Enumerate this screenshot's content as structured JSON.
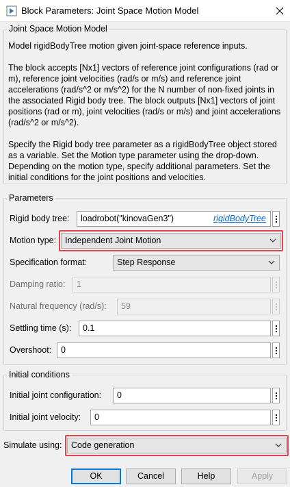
{
  "window": {
    "title": "Block Parameters: Joint Space Motion Model",
    "icon": "block-icon",
    "close_icon": "close-icon"
  },
  "block_group": {
    "label": "Joint Space Motion Model",
    "paragraph1": "Model rigidBodyTree motion given joint-space reference inputs.",
    "paragraph2": "The block accepts [Nx1] vectors of reference joint configurations (rad or m), reference joint velocities (rad/s or m/s) and reference joint accelerations (rad/s^2 or m/s^2) for the N number of non-fixed joints in the associated Rigid body tree. The block outputs [Nx1] vectors of joint positions (rad or m), joint velocities (rad/s or m/s) and joint accelerations (rad/s^2 or m/s^2).",
    "paragraph3": "Specify the Rigid body tree parameter as a rigidBodyTree object stored as a variable. Set the Motion type parameter using the drop-down. Depending on the motion type, specify additional parameters. Set the initial conditions for the joint positions and velocities."
  },
  "parameters": {
    "label": "Parameters",
    "rigid_body_tree": {
      "label": "Rigid body tree:",
      "value": "loadrobot(\"kinovaGen3\")",
      "link": "rigidBodyTree"
    },
    "motion_type": {
      "label": "Motion type:",
      "value": "Independent Joint Motion"
    },
    "specification_format": {
      "label": "Specification format:",
      "value": "Step Response"
    },
    "damping_ratio": {
      "label": "Damping ratio:",
      "value": "1"
    },
    "natural_frequency": {
      "label": "Natural frequency (rad/s):",
      "value": "59"
    },
    "settling_time": {
      "label": "Settling time (s):",
      "value": "0.1"
    },
    "overshoot": {
      "label": "Overshoot:",
      "value": "0"
    }
  },
  "initial_conditions": {
    "label": "Initial conditions",
    "joint_configuration": {
      "label": "Initial joint configuration:",
      "value": "0"
    },
    "joint_velocity": {
      "label": "Initial joint velocity:",
      "value": "0"
    }
  },
  "simulate": {
    "label": "Simulate using:",
    "value": "Code generation"
  },
  "buttons": {
    "ok": "OK",
    "cancel": "Cancel",
    "help": "Help",
    "apply": "Apply"
  },
  "colors": {
    "highlight": "#e0474c",
    "link": "#0066cc",
    "default_button_border": "#0078d7"
  }
}
